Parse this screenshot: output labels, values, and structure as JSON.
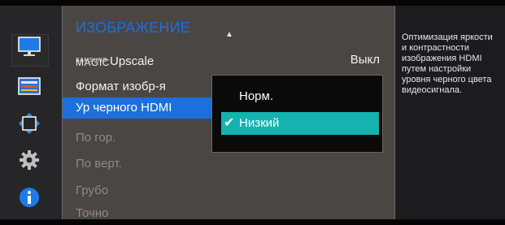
{
  "sidebar": {
    "items": [
      {
        "icon": "monitor-icon",
        "selected": true
      },
      {
        "icon": "color-icon",
        "selected": false
      },
      {
        "icon": "position-icon",
        "selected": false
      },
      {
        "icon": "gear-icon",
        "selected": false
      },
      {
        "icon": "info-icon",
        "selected": false
      }
    ]
  },
  "menu": {
    "title": "ИЗОБРАЖЕНИЕ",
    "scroll_up": "▲",
    "magic_upscale": {
      "brand_small": "SAMSUNG",
      "brand_large": "MAGIC",
      "label": "Upscale",
      "value": "Выкл"
    },
    "items": [
      {
        "label": "Формат изобр-я",
        "dim": false
      },
      {
        "label": "Ур черного HDMI",
        "dim": false,
        "selected": true
      },
      {
        "label": "По гор.",
        "dim": true
      },
      {
        "label": "По верт.",
        "dim": true
      },
      {
        "label": "Грубо",
        "dim": true
      },
      {
        "label": "Точно",
        "dim": true
      }
    ]
  },
  "submenu": {
    "options": [
      {
        "label": "Норм.",
        "active": false
      },
      {
        "label": "Низкий",
        "active": true,
        "check": "✔"
      }
    ]
  },
  "help": {
    "lines": [
      "Оптимизация яркости",
      "и контрастности",
      "изображения HDMI",
      "путем настройки",
      "уровня черного цвета",
      "видеосигнала."
    ]
  },
  "colors": {
    "accent_blue": "#1d6fdc",
    "active_teal": "#14b3b0",
    "panel": "#4a4644"
  }
}
